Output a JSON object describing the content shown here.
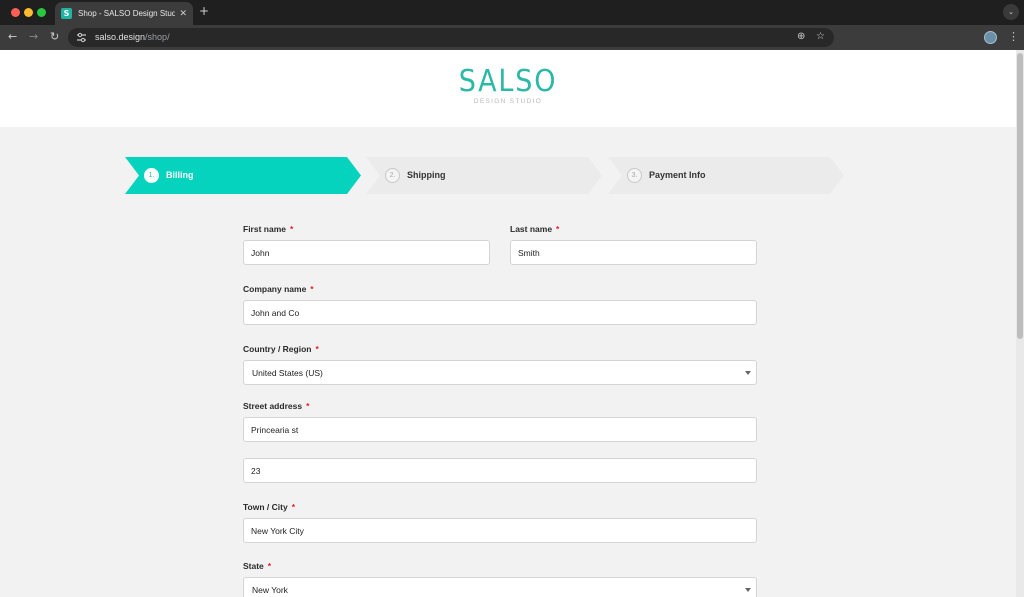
{
  "browser": {
    "tab_title": "Shop - SALSO Design Studio",
    "tab_favicon_letter": "S",
    "url_host": "salso.design",
    "url_path": "/shop/"
  },
  "header": {
    "logo_main": "SALSO",
    "logo_sub": "DESIGN STUDIO"
  },
  "steps": [
    {
      "number": "1.",
      "label": "Billing"
    },
    {
      "number": "2.",
      "label": "Shipping"
    },
    {
      "number": "3.",
      "label": "Payment Info"
    }
  ],
  "form": {
    "required_mark": "*",
    "first_name": {
      "label": "First name",
      "value": "John"
    },
    "last_name": {
      "label": "Last name",
      "value": "Smith"
    },
    "company": {
      "label": "Company name",
      "value": "John and Co"
    },
    "country": {
      "label": "Country / Region",
      "value": "United States (US)"
    },
    "street": {
      "label": "Street address",
      "value1": "Princearia st",
      "value2": "23"
    },
    "city": {
      "label": "Town / City",
      "value": "New York City"
    },
    "state": {
      "label": "State",
      "value": "New York"
    }
  },
  "colors": {
    "accent": "#06d3bd",
    "logo": "#2bb8a6",
    "required": "#e02020"
  }
}
